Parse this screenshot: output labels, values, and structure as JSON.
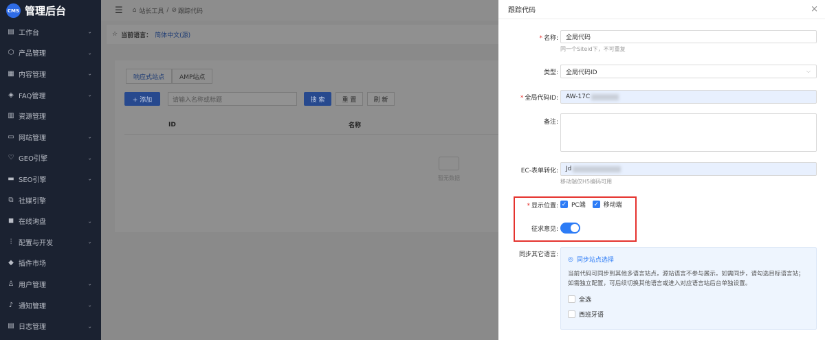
{
  "sidebar": {
    "logo_badge": "CMS",
    "logo_text": "管理后台",
    "items": [
      {
        "label": "工作台",
        "icon": "dashboard-icon",
        "chevron": true
      },
      {
        "label": "产品管理",
        "icon": "box-icon",
        "chevron": true
      },
      {
        "label": "内容管理",
        "icon": "document-icon",
        "chevron": true
      },
      {
        "label": "FAQ管理",
        "icon": "faq-icon",
        "chevron": true
      },
      {
        "label": "资源管理",
        "icon": "folder-icon",
        "chevron": false
      },
      {
        "label": "网站管理",
        "icon": "website-icon",
        "chevron": true
      },
      {
        "label": "GEO引擎",
        "icon": "heart-icon",
        "chevron": true
      },
      {
        "label": "SEO引擎",
        "icon": "monitor-icon",
        "chevron": true
      },
      {
        "label": "社媒引擎",
        "icon": "share-icon",
        "chevron": false
      },
      {
        "label": "在线询盘",
        "icon": "chat-icon",
        "chevron": true
      },
      {
        "label": "配置与开发",
        "icon": "sliders-icon",
        "chevron": true
      },
      {
        "label": "插件市场",
        "icon": "plugin-icon",
        "chevron": false
      },
      {
        "label": "用户管理",
        "icon": "user-icon",
        "chevron": true
      },
      {
        "label": "通知管理",
        "icon": "bell-icon",
        "chevron": true
      },
      {
        "label": "日志管理",
        "icon": "log-icon",
        "chevron": true
      }
    ]
  },
  "topbar": {
    "crumb1": "站长工具",
    "sep": "/",
    "crumb2": "跟踪代码"
  },
  "langbar": {
    "label": "当前语言：",
    "value": "简体中文(源)"
  },
  "main": {
    "tabs": [
      "响应式站点",
      "AMP站点"
    ],
    "add_label": "+ 添加",
    "search_placeholder": "请输入名称或标题",
    "search_label": "搜 索",
    "reset_label": "重 置",
    "refresh_label": "刷 新",
    "col_id": "ID",
    "col_name": "名称",
    "empty_text": "暂无数据"
  },
  "drawer": {
    "title": "跟踪代码",
    "close": "×",
    "name_label": "名称:",
    "name_value": "全局代码",
    "name_help": "同一个Siteid下，不可重复",
    "type_label": "类型:",
    "type_value": "全局代码ID",
    "gid_label": "全局代码ID:",
    "gid_value": "AW-17C",
    "remark_label": "备注:",
    "ec_label": "EC-表单转化:",
    "ec_value": "Jd",
    "ec_help": "移动端仅H5编码可用",
    "pos_label": "显示位置:",
    "pos_pc": "PC端",
    "pos_mobile": "移动端",
    "consent_label": "征求意见:",
    "consent_on": true,
    "sync_label": "同步其它语言:",
    "sync_link": "同步站点选择",
    "sync_desc": "当前代码可同步到其他多语言站点，源站语言不参与展示。如需同步，请勾选目标语言站；如需独立配置，可后续切换其他语言或进入对应语言站后台单独设置。",
    "sync_all": "全选",
    "sync_es": "西班牙语"
  },
  "colors": {
    "accent": "#2d7cf6",
    "required": "#e5322d",
    "sidebar_bg": "#1b2231"
  }
}
